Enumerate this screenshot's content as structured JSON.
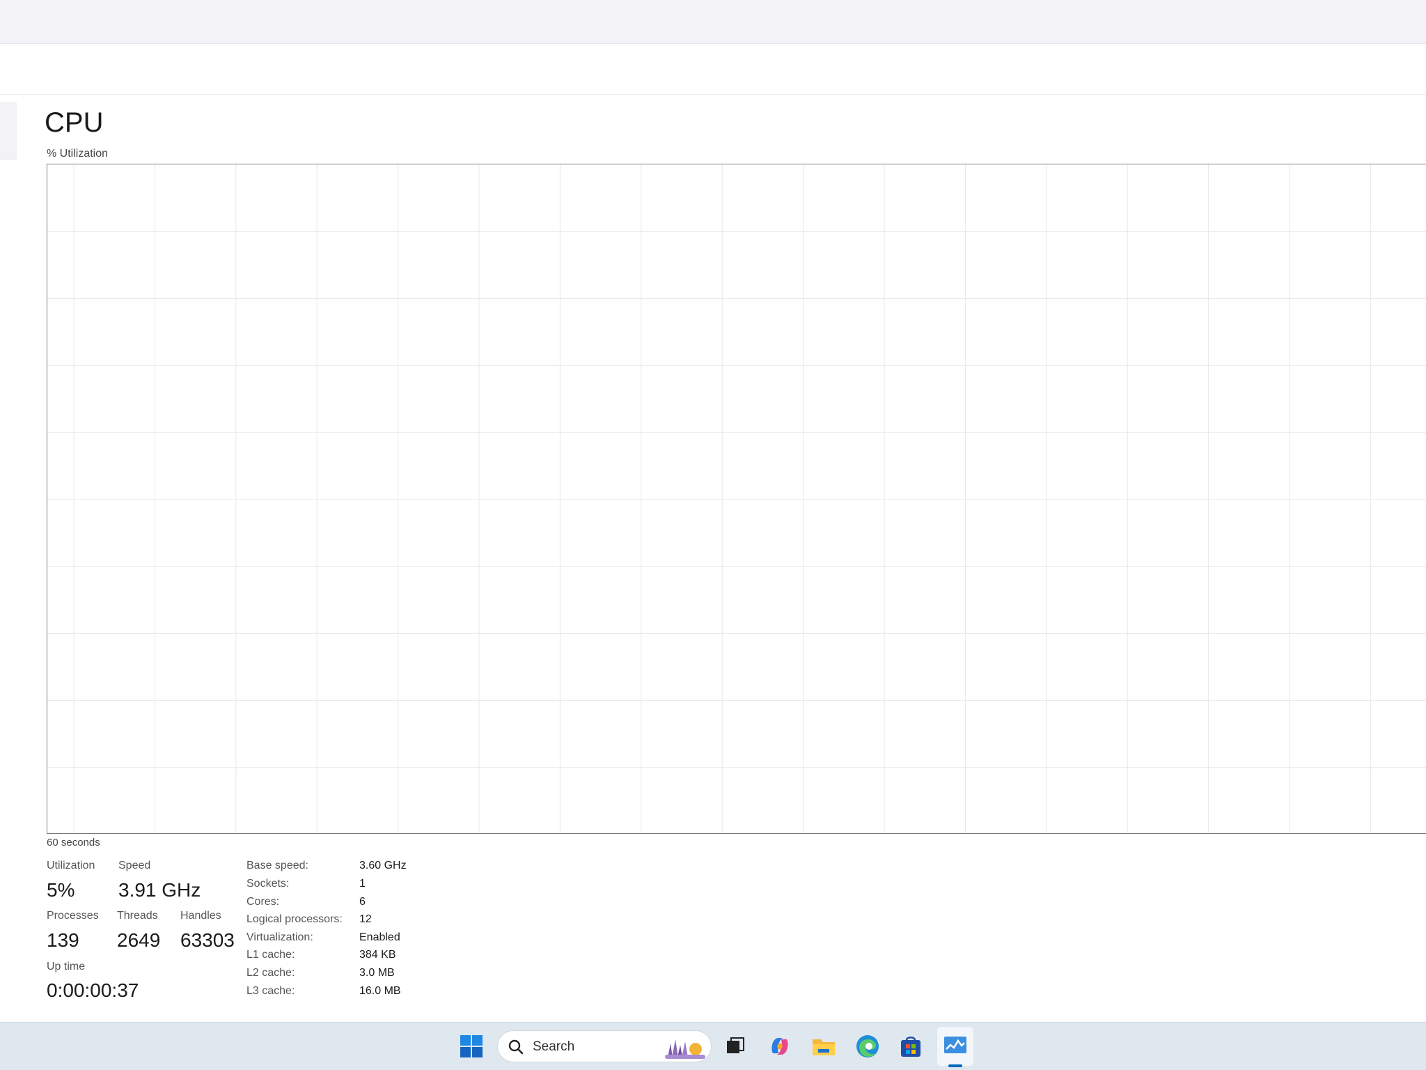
{
  "performance": {
    "title": "CPU",
    "utilization_axis_label": "% Utilization",
    "time_window_label": "60 seconds"
  },
  "stats": {
    "utilization": {
      "label": "Utilization",
      "value": "5%"
    },
    "speed": {
      "label": "Speed",
      "value": "3.91 GHz"
    },
    "processes": {
      "label": "Processes",
      "value": "139"
    },
    "threads": {
      "label": "Threads",
      "value": "2649"
    },
    "handles": {
      "label": "Handles",
      "value": "63303"
    },
    "uptime": {
      "label": "Up time",
      "value": "0:00:00:37"
    }
  },
  "specs": [
    {
      "label": "Base speed:",
      "value": "3.60 GHz"
    },
    {
      "label": "Sockets:",
      "value": "1"
    },
    {
      "label": "Cores:",
      "value": "6"
    },
    {
      "label": "Logical processors:",
      "value": "12"
    },
    {
      "label": "Virtualization:",
      "value": "Enabled"
    },
    {
      "label": "L1 cache:",
      "value": "384 KB"
    },
    {
      "label": "L2 cache:",
      "value": "3.0 MB"
    },
    {
      "label": "L3 cache:",
      "value": "16.0 MB"
    }
  ],
  "taskbar": {
    "search_label": "Search",
    "icons": [
      "windows-start-icon",
      "search-icon",
      "task-view-icon",
      "copilot-icon",
      "file-explorer-icon",
      "edge-icon",
      "store-icon",
      "task-manager-icon"
    ]
  },
  "colors": {
    "accent": "#0067c0",
    "graph_border": "#7a7a7a",
    "grid": "#e8e8ec",
    "taskbar": "#dfe7ef"
  }
}
